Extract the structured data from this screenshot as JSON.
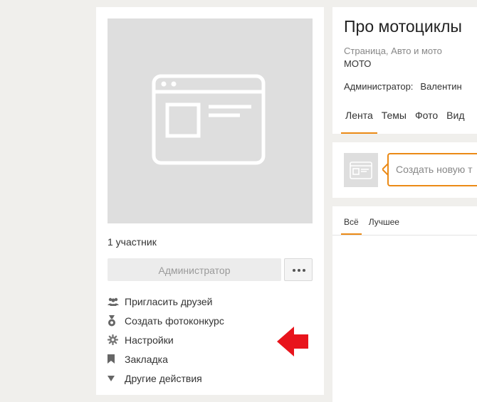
{
  "left": {
    "members": "1 участник",
    "admin_button": "Администратор",
    "actions": [
      {
        "label": "Пригласить друзей",
        "icon": "people-icon"
      },
      {
        "label": "Создать фотоконкурс",
        "icon": "medal-icon"
      },
      {
        "label": "Настройки",
        "icon": "gear-icon"
      },
      {
        "label": "Закладка",
        "icon": "bookmark-icon"
      },
      {
        "label": "Другие действия",
        "icon": "caret-down-icon"
      }
    ]
  },
  "group": {
    "title": "Про мотоциклы",
    "category": "Страница, Авто и мото",
    "tag": "МОТО",
    "admin_label": "Администратор:",
    "admin_name": "Валентин",
    "tabs": [
      {
        "label": "Лента",
        "active": true
      },
      {
        "label": "Темы",
        "active": false
      },
      {
        "label": "Фото",
        "active": false
      },
      {
        "label": "Вид",
        "active": false
      }
    ]
  },
  "post": {
    "placeholder": "Создать новую т"
  },
  "feed": {
    "tabs": [
      {
        "label": "Всё",
        "active": true
      },
      {
        "label": "Лучшее",
        "active": false
      }
    ]
  },
  "colors": {
    "accent": "#eb8a16",
    "arrow": "#e8141c",
    "placeholder_bg": "#dedede"
  }
}
